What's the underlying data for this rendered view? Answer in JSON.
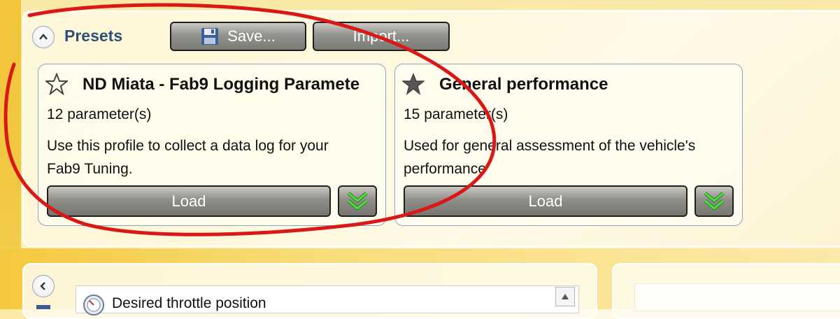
{
  "presets": {
    "title": "Presets",
    "save_label": "Save...",
    "import_label": "Import..."
  },
  "cards": [
    {
      "title": "ND Miata - Fab9 Logging Paramete",
      "count": "12 parameter(s)",
      "description_line1": "Use this profile to collect a data log for your",
      "description_line2": "Fab9 Tuning.",
      "load_label": "Load",
      "star_icon": "star-outline-icon"
    },
    {
      "title": "General performance",
      "count": "15 parameter(s)",
      "description_line1": "Used for general assessment of the vehicle's",
      "description_line2": "performance",
      "load_label": "Load",
      "star_icon": "star-filled-icon"
    }
  ],
  "parameters": {
    "row_label": "Desired throttle position"
  },
  "colors": {
    "accent_title": "#2f4f7a",
    "annotation": "#d91818",
    "chevron_green": "#39c32e"
  }
}
